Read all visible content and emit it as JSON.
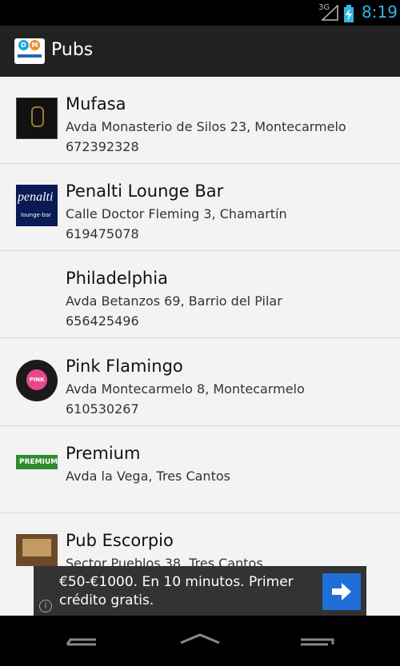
{
  "status_bar": {
    "network": "3G",
    "time": "8:19"
  },
  "action_bar": {
    "title": "Pubs",
    "logo_icon": "app-logo-icon",
    "logo_letters": [
      "D",
      "M"
    ]
  },
  "pubs": [
    {
      "name": "Mufasa",
      "address": "Avda Monasterio de Silos 23, Montecarmelo",
      "phone": "672392328"
    },
    {
      "name": "Penalti Lounge Bar",
      "address": "Calle Doctor Fleming 3, Chamartín",
      "phone": "619475078",
      "thumb_title": "penalti",
      "thumb_subtitle": "lounge-bar"
    },
    {
      "name": "Philadelphia",
      "address": "Avda Betanzos 69, Barrio del Pilar",
      "phone": "656425496"
    },
    {
      "name": "Pink Flamingo",
      "address": "Avda Montecarmelo 8, Montecarmelo",
      "phone": "610530267",
      "thumb_title": "PINK"
    },
    {
      "name": "Premium",
      "address": "Avda la Vega, Tres Cantos",
      "phone": "",
      "thumb_title": "PREMIUM"
    },
    {
      "name": "Pub Escorpio",
      "address": "Sector Pueblos 38, Tres Cantos",
      "phone": ""
    }
  ],
  "ad": {
    "text": "€50-€1000. En 10 minutos. Primer crédito gratis.",
    "info_glyph": "i"
  },
  "colors": {
    "status_clock": "#33b5e5",
    "action_bar": "#222222",
    "ad_button": "#1f6fd6"
  }
}
